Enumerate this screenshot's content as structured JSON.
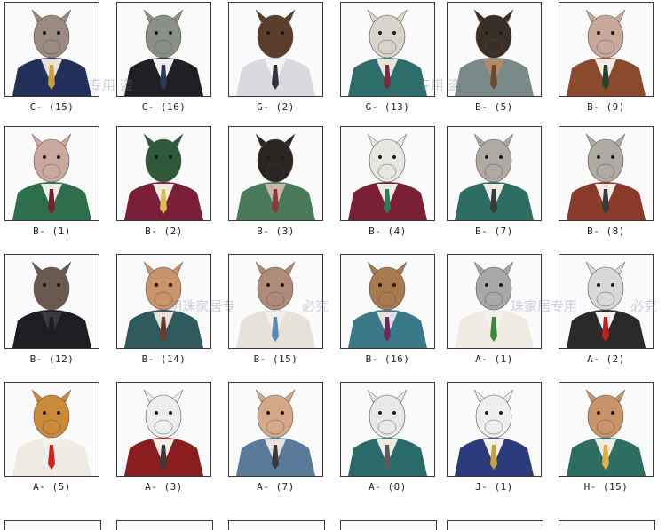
{
  "rows": [
    [
      {
        "caption": "C- (15)",
        "animal": "elephant",
        "head": "#9a8a80",
        "coat": "#23305a",
        "shirt": "#e8e2d8",
        "tie": "#c9a33a"
      },
      {
        "caption": "C- (16)",
        "animal": "t-rex",
        "head": "#8a8f88",
        "coat": "#1f1f24",
        "shirt": "#f1f1f1",
        "tie": "#2e3a5a"
      },
      {
        "caption": "G- (2)",
        "animal": "bear-hat",
        "head": "#5a3e2b",
        "coat": "#d9d9e0",
        "shirt": "#f4f4f4",
        "tie": "#333340"
      },
      {
        "caption": "G- (13)",
        "animal": "wolf-glasses",
        "head": "#d8d4cc",
        "coat": "#2e6e6a",
        "shirt": "#e8e4dc",
        "tie": "#7a2c3a"
      },
      {
        "caption": "B- (5)",
        "animal": "bear-archer",
        "head": "#3b2e25",
        "coat": "#7a8a88",
        "shirt": "#b08a6a",
        "tie": "#6a4a30"
      },
      {
        "caption": "B- (9)",
        "animal": "walrus",
        "head": "#c9a89c",
        "coat": "#8a4a2e",
        "shirt": "#f0ece4",
        "tie": "#24432f"
      }
    ],
    [
      {
        "caption": "B- (1)",
        "animal": "walrus-green",
        "head": "#c9a8a0",
        "coat": "#2f6e4a",
        "shirt": "#f0ece4",
        "tie": "#7a1e2a"
      },
      {
        "caption": "B- (2)",
        "animal": "duck",
        "head": "#2e5a3a",
        "coat": "#7a1e3a",
        "shirt": "#f0ece4",
        "tie": "#d8c050"
      },
      {
        "caption": "B- (3)",
        "animal": "black-bear",
        "head": "#2a2422",
        "coat": "#4a7a5a",
        "shirt": "#c9b8a8",
        "tie": "#8a3a3a"
      },
      {
        "caption": "B- (4)",
        "animal": "lemur",
        "head": "#e8e6e2",
        "coat": "#7a2035",
        "shirt": "#f0ece4",
        "tie": "#2e7a5a"
      },
      {
        "caption": "B- (7)",
        "animal": "rhino",
        "head": "#b0aaa4",
        "coat": "#2e6e62",
        "shirt": "#f0ece4",
        "tie": "#3a3a3a"
      },
      {
        "caption": "B- (8)",
        "animal": "rhino-red",
        "head": "#b0aaa4",
        "coat": "#8a3a2a",
        "shirt": "#f0ece4",
        "tie": "#3a3a3a"
      }
    ],
    [
      {
        "caption": "B- (12)",
        "animal": "stag",
        "head": "#6a5a4e",
        "coat": "#1e1e22",
        "shirt": "#3a3a40",
        "tie": "#1e1e22"
      },
      {
        "caption": "B- (14)",
        "animal": "kangaroo",
        "head": "#c9946a",
        "coat": "#2e5a5e",
        "shirt": "#e8e4dc",
        "tie": "#6a3a2a"
      },
      {
        "caption": "B- (15)",
        "animal": "walrus-beanie",
        "head": "#b08a78",
        "coat": "#e6e2da",
        "shirt": "#f4f0ea",
        "tie": "#5a8ab0"
      },
      {
        "caption": "B- (16)",
        "animal": "goat",
        "head": "#a87a4e",
        "coat": "#3a7a88",
        "shirt": "#e8e0e4",
        "tie": "#6a2a5a"
      },
      {
        "caption": "A- (1)",
        "animal": "koala",
        "head": "#a8a8a8",
        "coat": "#f0ece4",
        "shirt": "#f4f0ea",
        "tie": "#3a8a3a"
      },
      {
        "caption": "A- (2)",
        "animal": "zebra-hat",
        "head": "#d8d8d8",
        "coat": "#2a2a2a",
        "shirt": "#f4f4f4",
        "tie": "#c02020"
      }
    ],
    [
      {
        "caption": "A- (5)",
        "animal": "cat-goggles",
        "head": "#c98a3a",
        "coat": "#f0ece4",
        "shirt": "#f4f0ea",
        "tie": "#d02020"
      },
      {
        "caption": "A- (3)",
        "animal": "rabbit",
        "head": "#eeeeee",
        "coat": "#8a1e1e",
        "shirt": "#f4f0ea",
        "tie": "#3a3a3a"
      },
      {
        "caption": "A- (7)",
        "animal": "dog-mail",
        "head": "#d4a888",
        "coat": "#5a7a9a",
        "shirt": "#e8e4dc",
        "tie": "#3a3a3a"
      },
      {
        "caption": "A- (8)",
        "animal": "zebra",
        "head": "#e8e8e8",
        "coat": "#2a6a68",
        "shirt": "#f0ece4",
        "tie": "#5a5a5a"
      },
      {
        "caption": "J- (1)",
        "animal": "sea-captain",
        "head": "#eeeeee",
        "coat": "#2a3a7a",
        "shirt": "#f4f0ea",
        "tie": "#c9a33a"
      },
      {
        "caption": "H- (15)",
        "animal": "deer-flowers",
        "head": "#c9946a",
        "coat": "#2e6e62",
        "shirt": "#f0ece4",
        "tie": "#e0b040"
      }
    ]
  ],
  "watermarks": [
    {
      "text": "专用 盗"
    },
    {
      "text": "专用 盗"
    },
    {
      "text": "明珠家居专"
    },
    {
      "text": "必究"
    },
    {
      "text": "珠家居专用"
    },
    {
      "text": "必究"
    }
  ]
}
